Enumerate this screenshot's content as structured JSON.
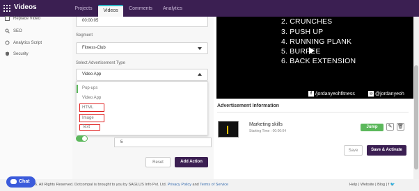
{
  "header": {
    "app_title": "Videos",
    "tabs": [
      {
        "label": "Projects"
      },
      {
        "label": "Videos"
      },
      {
        "label": "Comments"
      },
      {
        "label": "Analytics"
      }
    ]
  },
  "sidebar": {
    "items": [
      {
        "label": "Replace Video",
        "icon": "replace-icon"
      },
      {
        "label": "SEO",
        "icon": "search-icon"
      },
      {
        "label": "Analytics Script",
        "icon": "script-icon"
      },
      {
        "label": "Security",
        "icon": "shield-icon"
      }
    ]
  },
  "form": {
    "time_value": "00:00:05",
    "segment_label": "Segment",
    "segment_value": "Fitness-Club",
    "adv_type_label": "Select Advertisement Type",
    "adv_type_value": "Video App",
    "options": [
      "Pop-ups",
      "Video App",
      "HTML",
      "Image",
      "Text"
    ],
    "number_value": "5",
    "reset_label": "Reset",
    "add_action_label": "Add Action"
  },
  "video": {
    "lines": [
      "2. CRUNCHES",
      "3. PUSH UP",
      "4. RUNNING PLANK",
      "5. BURPEE",
      "6. BACK EXTENSION"
    ],
    "social_facebook": "/jordanyeohfitness",
    "social_instagram": "@jordanyeoh"
  },
  "advertisement": {
    "heading": "Advertisement Information",
    "item_title": "Marketing skills",
    "item_time": "Starting Time : 00:00:04",
    "jump_label": "Jump",
    "save_label": "Save",
    "save_activate_label": "Save & Activate"
  },
  "footer": {
    "copyright": "6. All Rights Reserved. Dotcompal is brought to you by SAGLUS Info Pvt. Ltd.",
    "privacy": "Privacy Policy",
    "and": "and",
    "terms": "Terms of Service",
    "help": "Help",
    "website": "Website",
    "blog": "Blog",
    "chat_label": "Chat"
  },
  "colors": {
    "brand": "#3b1f52",
    "accent_tab": "#2fb7c7",
    "success": "#5cb85c",
    "highlight": "#e02020",
    "chat": "#3b5bdb"
  }
}
